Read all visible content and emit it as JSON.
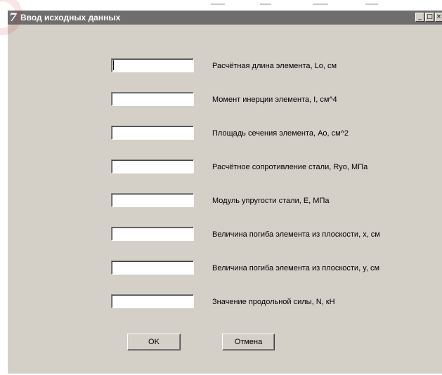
{
  "window": {
    "title": "Ввод исходных данных",
    "app_icon_glyph": "7",
    "controls": {
      "minimize": "_",
      "maximize": "□",
      "close": "×"
    }
  },
  "fields": [
    {
      "label": "Расчётная длина элемента, Lo, см",
      "value": ""
    },
    {
      "label": "Момент инерции элемента, I, см^4",
      "value": ""
    },
    {
      "label": "Площадь сечения элемента, Ao, см^2",
      "value": ""
    },
    {
      "label": "Расчётное сопротивление стали, Ryo, МПа",
      "value": ""
    },
    {
      "label": "Модуль упругости стали, E, МПа",
      "value": ""
    },
    {
      "label": "Величина погиба элемента из плоскости, x, см",
      "value": ""
    },
    {
      "label": "Величина погиба элемента из плоскости, y, см",
      "value": ""
    },
    {
      "label": "Значение продольной силы, N, кН",
      "value": ""
    }
  ],
  "buttons": {
    "ok": "OK",
    "cancel": "Отмена"
  },
  "colors": {
    "titlebar": "#6e6e6e",
    "face": "#d4d0c8",
    "input": "#ffffff"
  },
  "icons": {
    "app": "app-icon",
    "minimize": "minimize-icon",
    "maximize": "maximize-icon",
    "close": "close-icon"
  }
}
